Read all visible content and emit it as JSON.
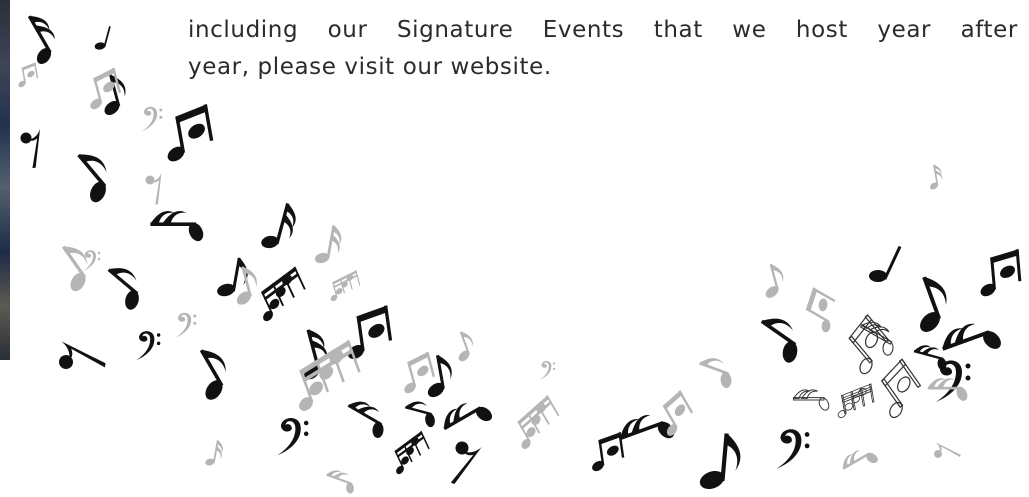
{
  "paragraph": {
    "line_1": "including our Signature Events that we host year after",
    "line_2": "year, please visit our website."
  },
  "decoration": {
    "icon": "music-notes-icon",
    "colors": {
      "dark_note": "#111111",
      "light_note": "#b5b5b5",
      "text": "#2b2b2b"
    }
  }
}
